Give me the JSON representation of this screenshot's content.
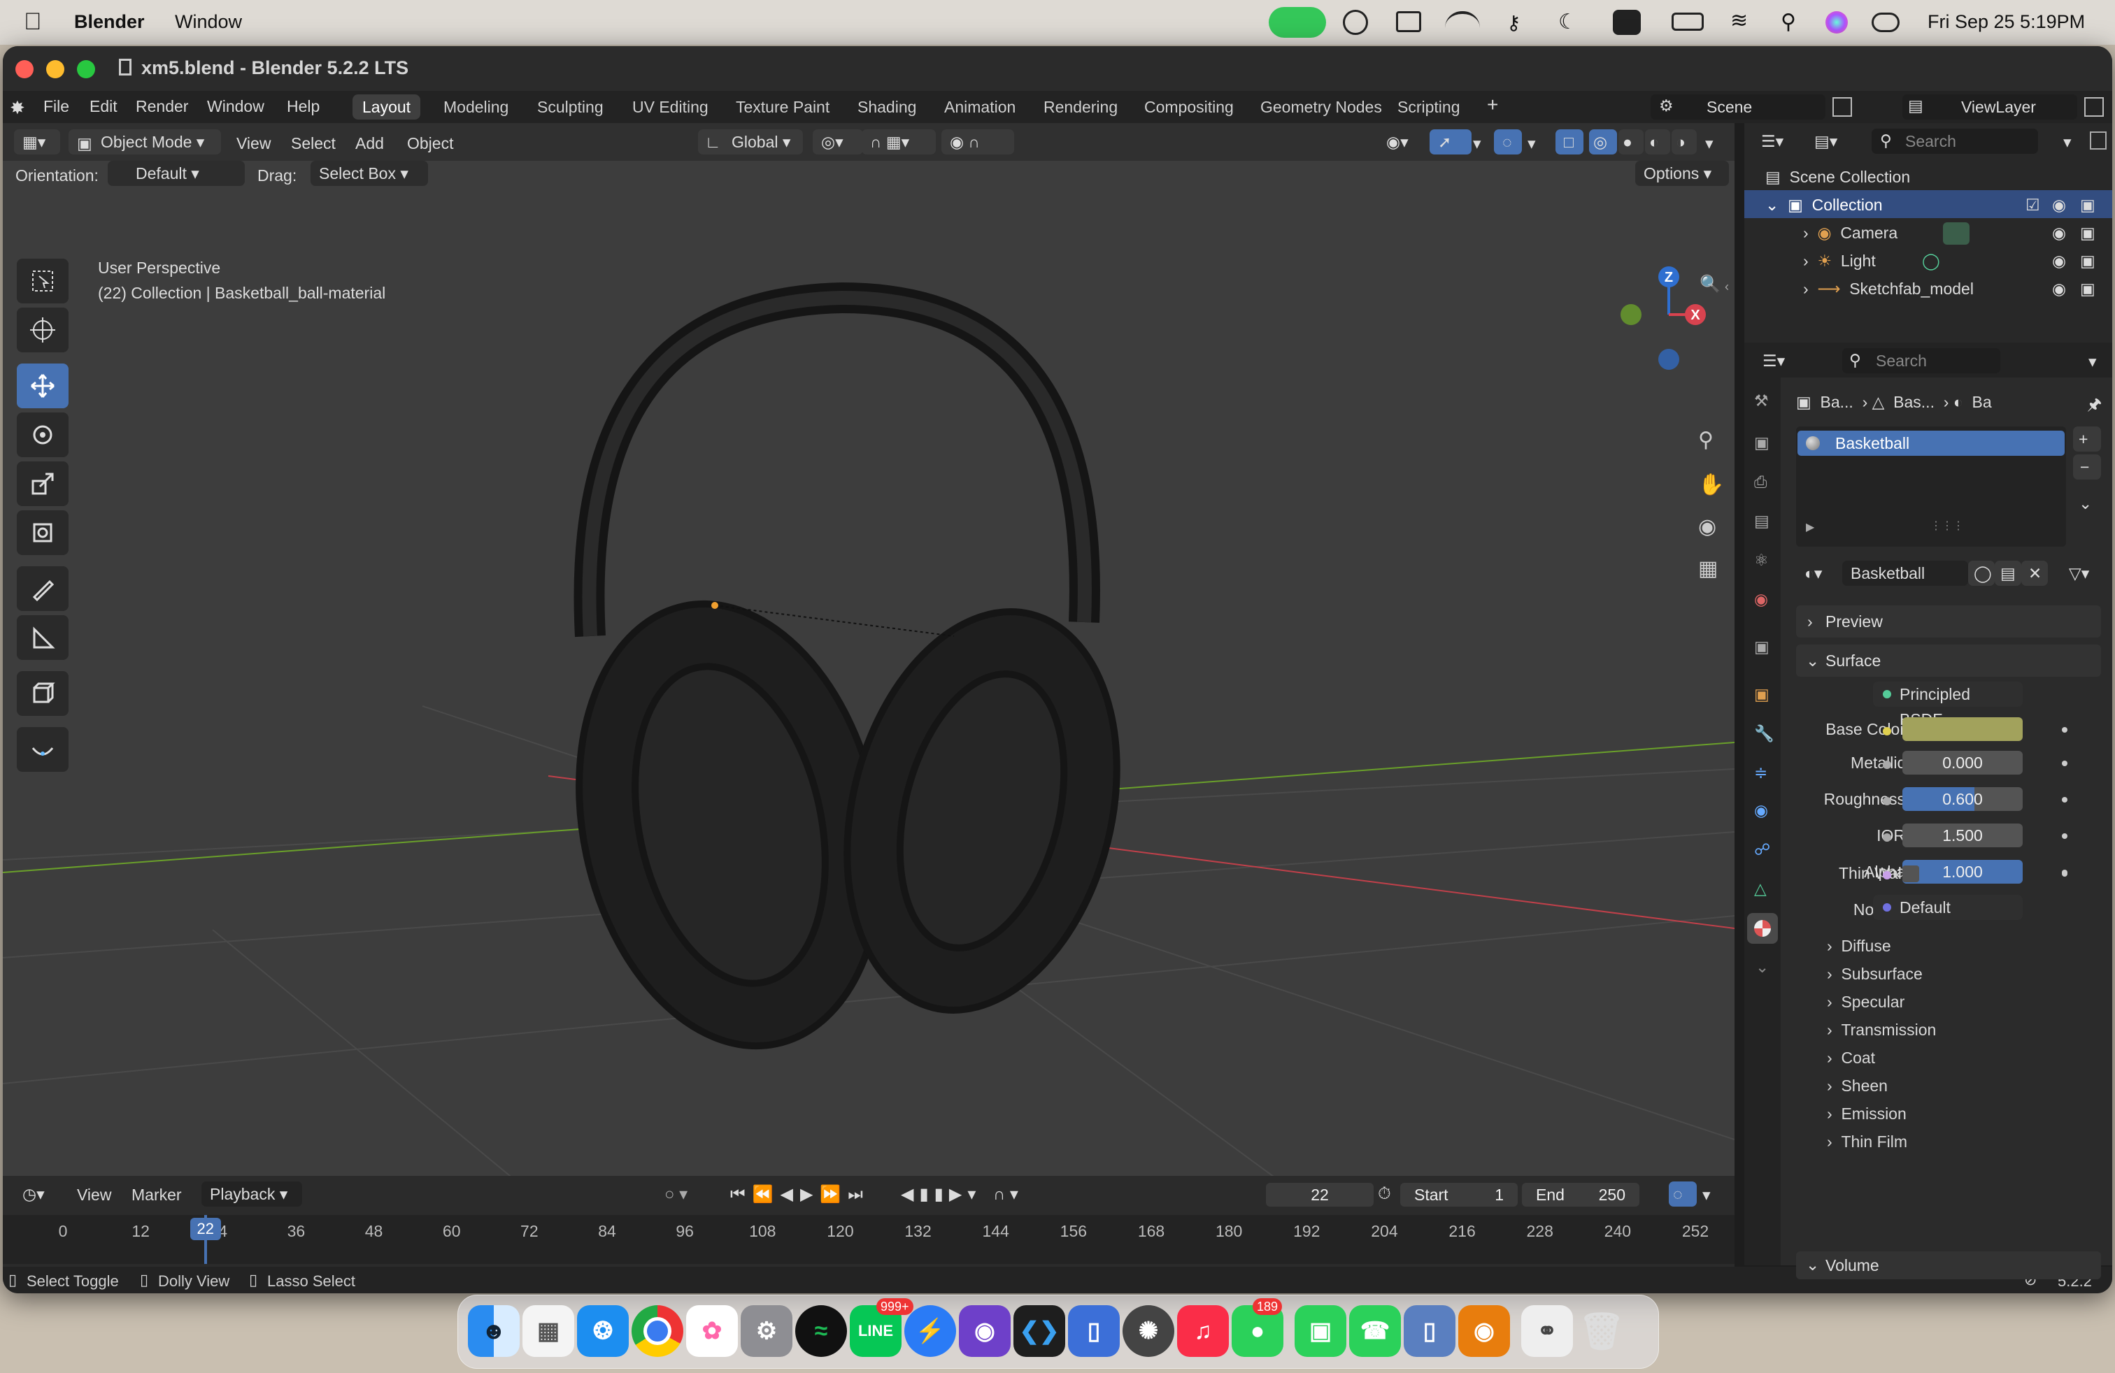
{
  "menubar": {
    "app_name": "Blender",
    "menu": "Window",
    "datetime": "Fri Sep 25  5:19PM"
  },
  "window": {
    "title": "xm5.blend - Blender 5.2.2 LTS"
  },
  "topbar": {
    "menus": [
      "File",
      "Edit",
      "Render",
      "Window",
      "Help"
    ],
    "workspaces": [
      "Layout",
      "Modeling",
      "Sculpting",
      "UV Editing",
      "Texture Paint",
      "Shading",
      "Animation",
      "Rendering",
      "Compositing",
      "Geometry Nodes",
      "Scripting"
    ],
    "active_workspace": "Layout",
    "scene": "Scene",
    "view_layer": "ViewLayer"
  },
  "viewport_header": {
    "mode": "Object Mode",
    "menus": [
      "View",
      "Select",
      "Add",
      "Object"
    ],
    "transform_orientation": "Global",
    "orientation_label": "Orientation:",
    "orientation_value": "Default",
    "drag_label": "Drag:",
    "drag_value": "Select Box",
    "options_label": "Options"
  },
  "viewport": {
    "perspective": "User Perspective",
    "context": "(22) Collection | Basketball_ball-material",
    "gizmo_axes": [
      "Z",
      "X"
    ]
  },
  "timeline": {
    "menus": [
      "View",
      "Marker"
    ],
    "playback": "Playback",
    "current_frame": "22",
    "start_label": "Start",
    "start_value": "1",
    "end_label": "End",
    "end_value": "250",
    "ruler": [
      "0",
      "12",
      "24",
      "36",
      "48",
      "60",
      "72",
      "84",
      "96",
      "108",
      "120",
      "132",
      "144",
      "156",
      "168",
      "180",
      "192",
      "204",
      "216",
      "228",
      "240",
      "252"
    ],
    "playhead_label": "22"
  },
  "status_bar": {
    "hints": [
      "Select Toggle",
      "Dolly View",
      "Lasso Select"
    ],
    "version": "5.2.2"
  },
  "outliner": {
    "search_placeholder": "Search",
    "scene_collection": "Scene Collection",
    "collection": "Collection",
    "items": [
      "Camera",
      "Light",
      "Sketchfab_model"
    ]
  },
  "properties": {
    "search_placeholder": "Search",
    "breadcrumb": [
      "Ba...",
      "Bas...",
      "Ba"
    ],
    "material_slot": "Basketball",
    "material_name": "Basketball",
    "panels": {
      "preview": "Preview",
      "surface": "Surface",
      "volume": "Volume"
    },
    "surface_label": "Surface",
    "surface_shader": "Principled BSDF",
    "base_color_label": "Base Color",
    "base_color": "#a2a25c",
    "fields": [
      {
        "label": "Metallic",
        "value": "0.000",
        "fill": 0.0
      },
      {
        "label": "Roughness",
        "value": "0.600",
        "fill": 0.6
      },
      {
        "label": "IOR",
        "value": "1.500",
        "fill": 0.0
      },
      {
        "label": "Alpha",
        "value": "1.000",
        "fill": 1.0
      }
    ],
    "thin_wall_label": "Thin Wall",
    "normal_label": "Normal",
    "normal_value": "Default",
    "subpanels": [
      "Diffuse",
      "Subsurface",
      "Specular",
      "Transmission",
      "Coat",
      "Sheen",
      "Emission",
      "Thin Film"
    ]
  },
  "dock": {
    "badges": {
      "line": "999+",
      "messages": "189"
    }
  },
  "colors": {
    "accent": "#4772b3",
    "x_axis": "#d8434f",
    "y_axis": "#6aa02a",
    "z_axis": "#2f6fd0"
  }
}
